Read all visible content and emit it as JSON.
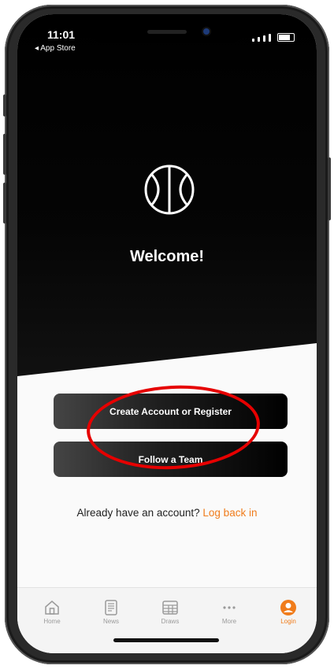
{
  "status_bar": {
    "time": "11:01",
    "back_label": "◂ App Store"
  },
  "hero": {
    "welcome": "Welcome!",
    "logo_icon": "basketball-icon"
  },
  "actions": {
    "create_label": "Create Account or Register",
    "follow_label": "Follow a Team"
  },
  "login_prompt": {
    "text": "Already have an account?",
    "link": "Log back in"
  },
  "tabs": [
    {
      "label": "Home",
      "icon": "home-icon",
      "active": false
    },
    {
      "label": "News",
      "icon": "news-icon",
      "active": false
    },
    {
      "label": "Draws",
      "icon": "draws-icon",
      "active": false
    },
    {
      "label": "More",
      "icon": "more-icon",
      "active": false
    },
    {
      "label": "Login",
      "icon": "user-icon",
      "active": true
    }
  ],
  "colors": {
    "accent": "#f07c1b",
    "annotation": "#e60000",
    "hero": "#000000"
  }
}
